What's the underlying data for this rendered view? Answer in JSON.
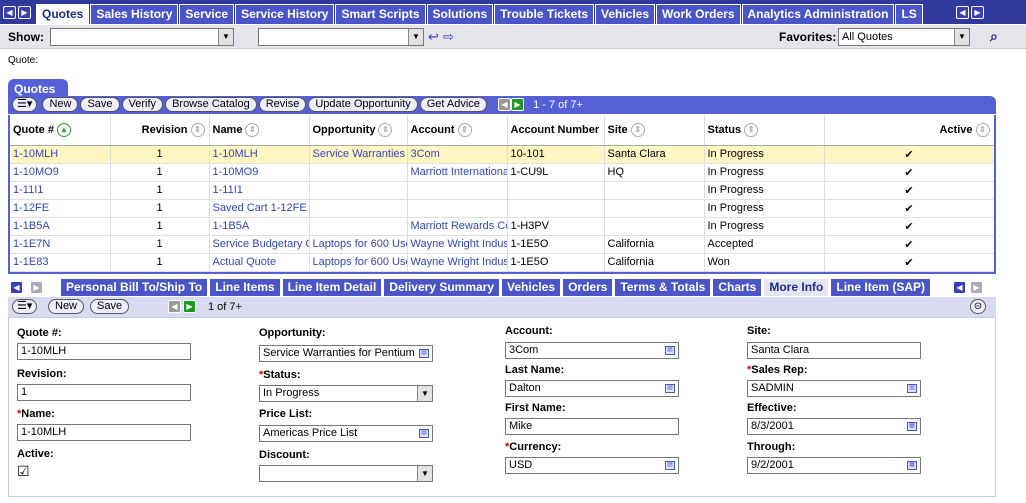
{
  "top_tabs": [
    "Quotes",
    "Sales History",
    "Service",
    "Service History",
    "Smart Scripts",
    "Solutions",
    "Trouble Tickets",
    "Vehicles",
    "Work Orders",
    "Analytics Administration",
    "LS"
  ],
  "showbar": {
    "show_label": "Show:",
    "favorites_label": "Favorites:",
    "favorites_value": "All Quotes"
  },
  "breadcrumb": "Quote:",
  "quotes": {
    "title": "Quotes",
    "buttons": [
      "New",
      "Save",
      "Verify",
      "Browse Catalog",
      "Revise",
      "Update Opportunity",
      "Get Advice"
    ],
    "record_count": "1 - 7 of 7+",
    "columns": [
      "Quote #",
      "Revision",
      "Name",
      "Opportunity",
      "Account",
      "Account Number",
      "Site",
      "Status",
      "Active"
    ],
    "rows": [
      [
        "1-10MLH",
        "1",
        "1-10MLH",
        "Service Warranties",
        "3Com",
        "10-101",
        "Santa Clara",
        "In Progress",
        "✔"
      ],
      [
        "1-10MO9",
        "1",
        "1-10MO9",
        "",
        "Marriott Internationa",
        "1-CU9L",
        "HQ",
        "In Progress",
        "✔"
      ],
      [
        "1-11I1",
        "1",
        "1-11I1",
        "",
        "",
        "",
        "",
        "In Progress",
        "✔"
      ],
      [
        "1-12FE",
        "1",
        "Saved Cart 1-12FE",
        "",
        "",
        "",
        "",
        "In Progress",
        "✔"
      ],
      [
        "1-1B5A",
        "1",
        "1-1B5A",
        "",
        "Marriott Rewards Co",
        "1-H3PV",
        "",
        "In Progress",
        "✔"
      ],
      [
        "1-1E7N",
        "1",
        "Service Budgetary Q",
        "Laptops for 600 Use",
        "Wayne Wright Indus",
        "1-1E5O",
        "California",
        "Accepted",
        "✔"
      ],
      [
        "1-1E83",
        "1",
        "Actual Quote",
        "Laptops for 600 Use",
        "Wayne Wright Indus",
        "1-1E5O",
        "California",
        "Won",
        "✔"
      ]
    ]
  },
  "lower_tabs": [
    "Personal Bill To/Ship To",
    "Line Items",
    "Line Item Detail",
    "Delivery Summary",
    "Vehicles",
    "Orders",
    "Terms & Totals",
    "Charts",
    "More Info",
    "Line Item (SAP)"
  ],
  "form_bar": {
    "buttons": [
      "New",
      "Save"
    ],
    "record_count": "1 of 7+"
  },
  "form": {
    "quote_label": "Quote #:",
    "quote_value": "1-10MLH",
    "revision_label": "Revision:",
    "revision_value": "1",
    "name_label": "Name:",
    "name_value": "1-10MLH",
    "active_label": "Active:",
    "active_value": "☑",
    "opportunity_label": "Opportunity:",
    "opportunity_value": "Service Warranties for Pentium",
    "status_label": "Status:",
    "status_value": "In Progress",
    "pricelist_label": "Price List:",
    "pricelist_value": "Americas Price List",
    "discount_label": "Discount:",
    "discount_value": "",
    "account_label": "Account:",
    "account_value": "3Com",
    "lastname_label": "Last Name:",
    "lastname_value": "Dalton",
    "firstname_label": "First Name:",
    "firstname_value": "Mike",
    "currency_label": "Currency:",
    "currency_value": "USD",
    "site_label": "Site:",
    "site_value": "Santa Clara",
    "salesrep_label": "Sales Rep:",
    "salesrep_value": "SADMIN",
    "effective_label": "Effective:",
    "effective_value": "8/3/2001",
    "through_label": "Through:",
    "through_value": "9/2/2001",
    "required_mark": "*"
  }
}
